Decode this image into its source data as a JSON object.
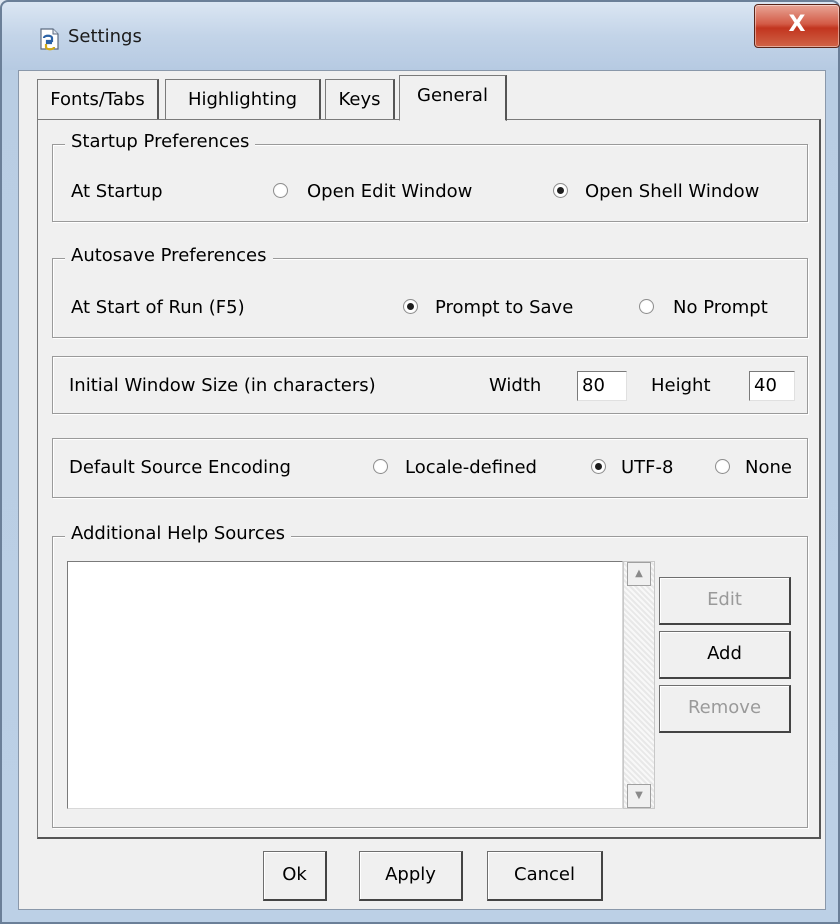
{
  "window": {
    "title": "Settings",
    "close_glyph": "X"
  },
  "tabs": [
    {
      "label": "Fonts/Tabs"
    },
    {
      "label": "Highlighting"
    },
    {
      "label": "Keys"
    },
    {
      "label": "General"
    }
  ],
  "startup": {
    "legend": "Startup Preferences",
    "label": "At Startup",
    "options": [
      {
        "label": "Open Edit Window",
        "selected": false
      },
      {
        "label": "Open Shell Window",
        "selected": true
      }
    ]
  },
  "autosave": {
    "legend": "Autosave Preferences",
    "label": "At Start of Run (F5)",
    "options": [
      {
        "label": "Prompt to Save",
        "selected": true
      },
      {
        "label": "No Prompt",
        "selected": false
      }
    ]
  },
  "window_size": {
    "label": "Initial Window Size  (in characters)",
    "width_label": "Width",
    "width_value": "80",
    "height_label": "Height",
    "height_value": "40"
  },
  "encoding": {
    "label": "Default Source Encoding",
    "options": [
      {
        "label": "Locale-defined",
        "selected": false
      },
      {
        "label": "UTF-8",
        "selected": true
      },
      {
        "label": "None",
        "selected": false
      }
    ]
  },
  "help_sources": {
    "legend": "Additional Help Sources",
    "edit_label": "Edit",
    "add_label": "Add",
    "remove_label": "Remove"
  },
  "footer": {
    "ok_label": "Ok",
    "apply_label": "Apply",
    "cancel_label": "Cancel"
  },
  "icons": {
    "app": "python-idle-icon",
    "close": "close-icon",
    "scroll_up": "arrow-up-icon",
    "scroll_down": "arrow-down-icon"
  }
}
